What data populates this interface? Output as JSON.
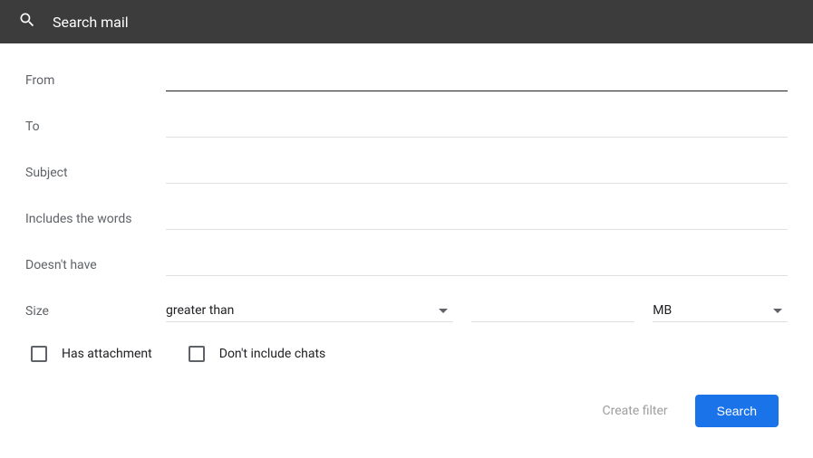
{
  "search": {
    "placeholder": "Search mail"
  },
  "fields": {
    "from_label": "From",
    "to_label": "To",
    "subject_label": "Subject",
    "includes_label": "Includes the words",
    "doesnt_label": "Doesn't have"
  },
  "size": {
    "label": "Size",
    "comparator": "greater than",
    "value": "",
    "unit": "MB"
  },
  "checkboxes": {
    "has_attachment": "Has attachment",
    "exclude_chats": "Don't include chats"
  },
  "actions": {
    "create_filter": "Create filter",
    "search": "Search"
  }
}
